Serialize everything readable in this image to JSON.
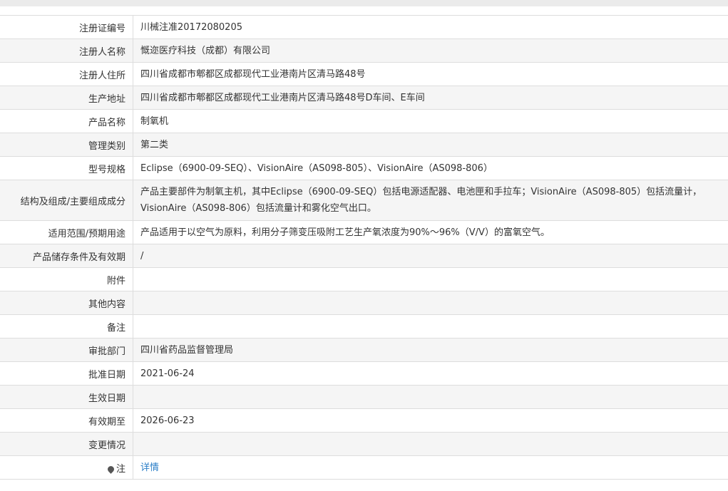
{
  "rows": [
    {
      "label": "注册证编号",
      "value": "川械注准20172080205"
    },
    {
      "label": "注册人名称",
      "value": "慨迩医疗科技（成都）有限公司"
    },
    {
      "label": "注册人住所",
      "value": "四川省成都市郫都区成都现代工业港南片区清马路48号"
    },
    {
      "label": "生产地址",
      "value": "四川省成都市郫都区成都现代工业港南片区清马路48号D车间、E车间"
    },
    {
      "label": "产品名称",
      "value": "制氧机"
    },
    {
      "label": "管理类别",
      "value": "第二类"
    },
    {
      "label": "型号规格",
      "value": "Eclipse（6900-09-SEQ）、VisionAire（AS098-805）、VisionAire（AS098-806）"
    },
    {
      "label": "结构及组成/主要组成成分",
      "value": "产品主要部件为制氧主机，其中Eclipse（6900-09-SEQ）包括电源适配器、电池匣和手拉车；VisionAire（AS098-805）包括流量计，VisionAire（AS098-806）包括流量计和雾化空气出口。"
    },
    {
      "label": "适用范围/预期用途",
      "value": "产品适用于以空气为原料，利用分子筛变压吸附工艺生产氧浓度为90%～96%（V/V）的富氧空气。"
    },
    {
      "label": "产品储存条件及有效期",
      "value": "/"
    },
    {
      "label": "附件",
      "value": ""
    },
    {
      "label": "其他内容",
      "value": ""
    },
    {
      "label": "备注",
      "value": ""
    },
    {
      "label": "审批部门",
      "value": "四川省药品监督管理局"
    },
    {
      "label": "批准日期",
      "value": "2021-06-24"
    },
    {
      "label": "生效日期",
      "value": ""
    },
    {
      "label": "有效期至",
      "value": "2026-06-23"
    },
    {
      "label": "变更情况",
      "value": ""
    }
  ],
  "note": {
    "label": "注",
    "link": "详情",
    "icon": "pin-icon"
  }
}
